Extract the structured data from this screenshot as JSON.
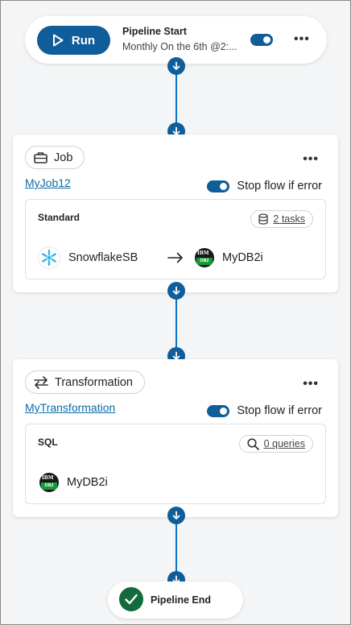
{
  "start": {
    "run_label": "Run",
    "title": "Pipeline Start",
    "schedule": "Monthly On the 6th @2:...",
    "more": "•••"
  },
  "job": {
    "chip_label": "Job",
    "name": "MyJob12",
    "stop_label": "Stop flow if error",
    "more": "•••",
    "inner_title": "Standard",
    "count": "2 tasks",
    "source": "SnowflakeSB",
    "target": "MyDB2i"
  },
  "transformation": {
    "chip_label": "Transformation",
    "name": "MyTransformation",
    "stop_label": "Stop flow if error",
    "more": "•••",
    "inner_title": "SQL",
    "count": "0 queries",
    "source": "MyDB2i"
  },
  "end": {
    "label": "Pipeline End"
  },
  "db2_logo": {
    "ibm": "IBM",
    "db2": "DB2"
  },
  "colors": {
    "primary": "#0f5d99",
    "connector": "#0b73c4",
    "link": "#0b6aa6",
    "end_check": "#136b3c",
    "snowflake": "#29b5e8"
  },
  "icons": {
    "run": "play-icon",
    "job": "briefcase-icon",
    "transformation": "swap-arrows-icon",
    "tasks": "database-icon",
    "queries": "search-icon",
    "end": "check-icon",
    "arrow": "arrow-right-icon",
    "node": "arrow-down-icon"
  }
}
